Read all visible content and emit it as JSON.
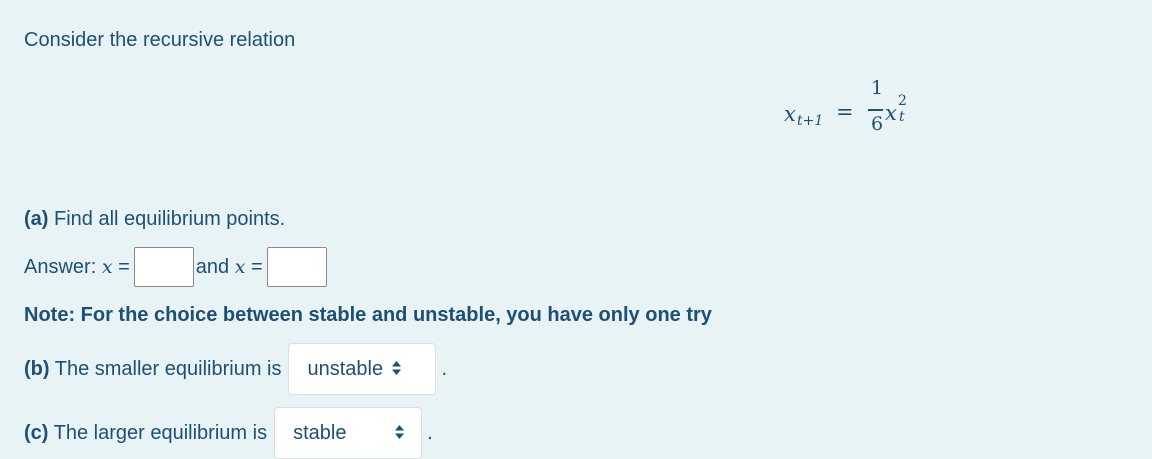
{
  "intro": "Consider the recursive relation",
  "equation": {
    "lhs_var": "x",
    "lhs_sub": "t+1",
    "equals": "=",
    "numerator": "1",
    "denominator": "6",
    "rhs_var": "x",
    "rhs_sup": "2",
    "rhs_sub": "t"
  },
  "part_a": {
    "label": "(a)",
    "text": " Find all equilibrium points."
  },
  "answer": {
    "prefix": "Answer: ",
    "var1": "x",
    "eq1": " =",
    "input1_value": "",
    "connector": "and ",
    "var2": "x",
    "eq2": " =",
    "input2_value": ""
  },
  "note": "Note: For the choice between stable and unstable, you have only one try",
  "part_b": {
    "label": "(b)",
    "text": " The smaller equilibrium is",
    "selected": "unstable",
    "period": "."
  },
  "part_c": {
    "label": "(c)",
    "text": " The larger equilibrium is",
    "selected": "stable",
    "period": "."
  },
  "icons": {
    "select_arrows": "up-down-arrows-icon"
  },
  "colors": {
    "background": "#e7f3f5",
    "text": "#1f4f74"
  }
}
